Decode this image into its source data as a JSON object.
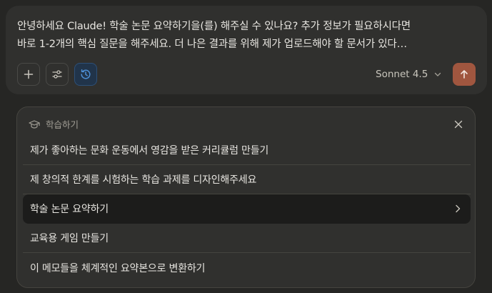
{
  "composer": {
    "prompt_line1": "안녕하세요 Claude! 학술 논문 요약하기을(를) 해주실 수 있나요? 추가 정보가 필요하시다면",
    "prompt_line2": "바로 1-2개의 핵심 질문을 해주세요. 더 나은 결과를 위해 제가 업로드해야 할 문서가 있다…",
    "tools": [
      {
        "icon": "plus-icon"
      },
      {
        "icon": "sliders-icon"
      },
      {
        "icon": "history-clock-icon"
      }
    ],
    "model_label": "Sonnet 4.5",
    "model_icon": "chevron-down-icon",
    "send_icon": "arrow-up-icon"
  },
  "panel": {
    "header_icon": "graduation-cap-icon",
    "header_label": "학습하기",
    "close_icon": "close-icon",
    "items": [
      {
        "label": "제가 좋아하는 문화 운동에서 영감을 받은 커리큘럼 만들기"
      },
      {
        "label": "제 창의적 한계를 시험하는 학습 과제를 디자인해주세요"
      },
      {
        "label": "학술 논문 요약하기",
        "selected": true
      },
      {
        "label": "교육용 게임 만들기"
      },
      {
        "label": "이 메모들을 체계적인 요약본으로 변환하기"
      }
    ]
  },
  "colors": {
    "background": "#262624",
    "surface": "#30302e",
    "accent_send": "#a0563f",
    "active_tool": "#21344a",
    "active_tool_icon": "#4d8fd6"
  }
}
